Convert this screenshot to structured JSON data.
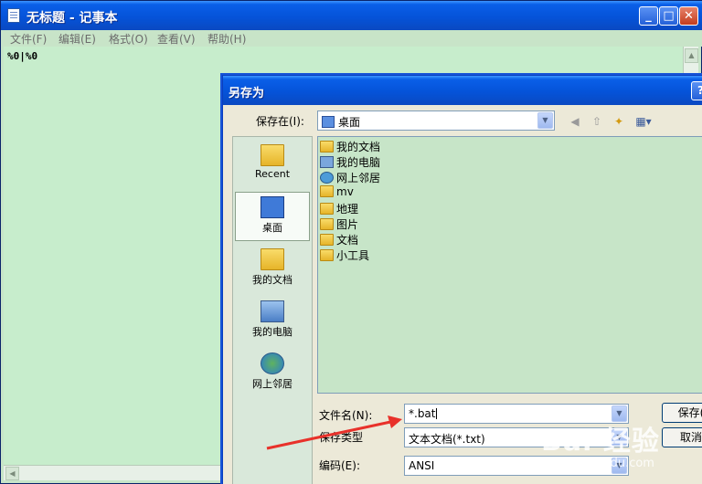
{
  "window": {
    "title": "无标题 - 记事本",
    "min": "_",
    "max": "□",
    "close": "✕"
  },
  "menu": [
    "文件(F)",
    "编辑(E)",
    "格式(O)",
    "查看(V)",
    "帮助(H)"
  ],
  "editor": {
    "content": "%0|%0"
  },
  "dialog": {
    "title": "另存为",
    "help": "?",
    "save_in_label": "保存在(I):",
    "save_in_value": "桌面",
    "places": [
      "Recent",
      "桌面",
      "我的文档",
      "我的电脑",
      "网上邻居"
    ],
    "files": [
      "我的文档",
      "我的电脑",
      "网上邻居",
      "mv",
      "地理",
      "图片",
      "文档",
      "小工具"
    ],
    "filename_label": "文件名(N):",
    "filename_value": "*.bat",
    "filetype_label": "保存类型",
    "filetype_value": "文本文档(*.txt)",
    "encoding_label": "编码(E):",
    "encoding_value": "ANSI",
    "save_button": "保存(",
    "cancel_button": "取消"
  },
  "watermark": {
    "text": "Bai 经验",
    "url": "jingyan.baidu.com"
  },
  "colors": {
    "titlebar": "#0553d9",
    "background": "#c7e5c8",
    "arrow": "#e8312a"
  }
}
